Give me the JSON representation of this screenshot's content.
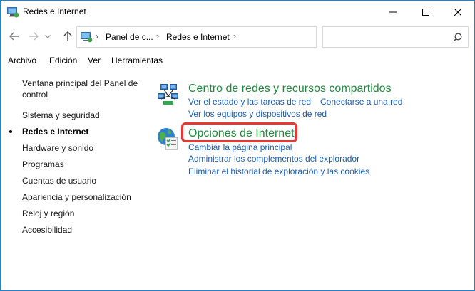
{
  "window": {
    "title": "Redes e Internet",
    "accent": "#1883d7"
  },
  "address": {
    "crumbs": [
      "Panel de c...",
      "Redes e Internet"
    ],
    "search_placeholder": ""
  },
  "menu": [
    "Archivo",
    "Edición",
    "Ver",
    "Herramientas"
  ],
  "sidebar": {
    "items": [
      {
        "label": "Ventana principal del Panel de control"
      },
      {
        "label": "Sistema y seguridad"
      },
      {
        "label": "Redes e Internet",
        "current": true
      },
      {
        "label": "Hardware y sonido"
      },
      {
        "label": "Programas"
      },
      {
        "label": "Cuentas de usuario"
      },
      {
        "label": "Apariencia y personalización"
      },
      {
        "label": "Reloj y región"
      },
      {
        "label": "Accesibilidad"
      }
    ]
  },
  "categories": [
    {
      "title": "Centro de redes y recursos compartidos",
      "icon": "network-center-icon",
      "links": [
        "Ver el estado y las tareas de red",
        "Conectarse a una red",
        "Ver los equipos y dispositivos de red"
      ]
    },
    {
      "title": "Opciones de Internet",
      "icon": "internet-options-icon",
      "links": [
        "Cambiar la página principal",
        "Administrar los complementos del explorador",
        "Eliminar el historial de exploración y las cookies"
      ]
    }
  ],
  "colors": {
    "category_title": "#1e8a3d",
    "link": "#1a5fb4",
    "highlight": "#e53935"
  }
}
